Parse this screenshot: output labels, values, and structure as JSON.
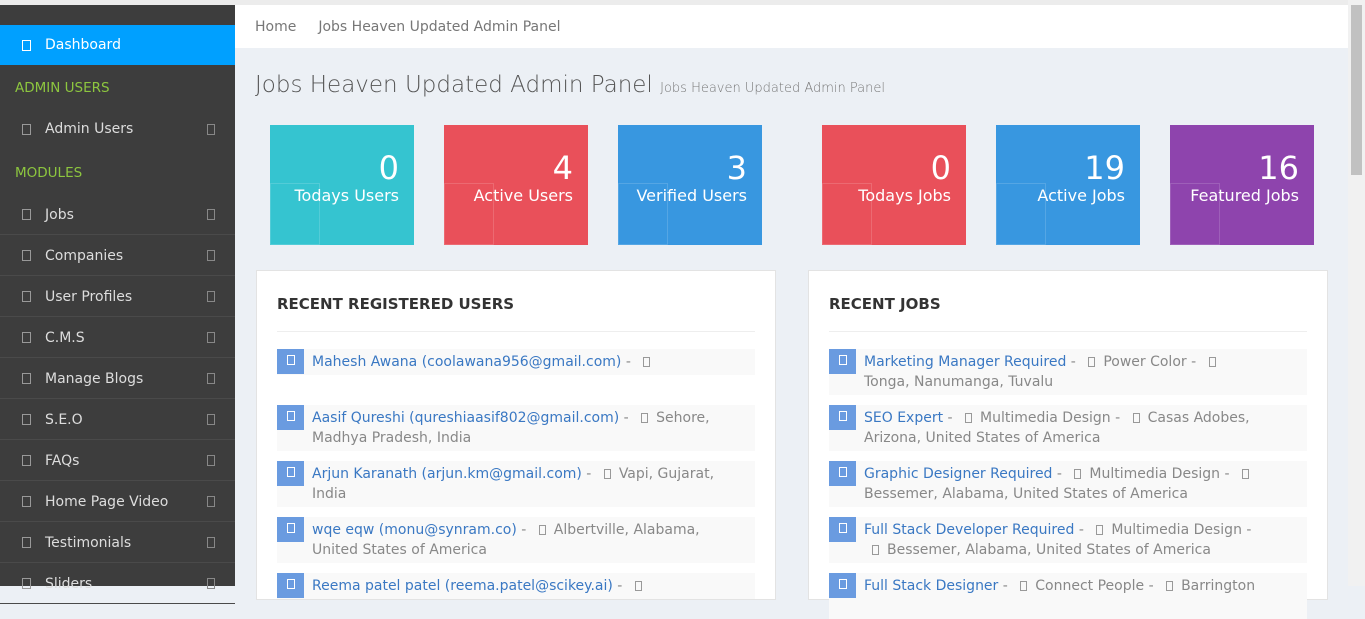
{
  "sidebar": {
    "dashboard": "Dashboard",
    "section_admin": "ADMIN USERS",
    "admin_users": "Admin Users",
    "section_modules": "MODULES",
    "items": [
      "Jobs",
      "Companies",
      "User Profiles",
      "C.M.S",
      "Manage Blogs",
      "S.E.O",
      "FAQs",
      "Home Page Video",
      "Testimonials",
      "Sliders"
    ]
  },
  "breadcrumb": {
    "home": "Home",
    "current": "Jobs Heaven Updated Admin Panel"
  },
  "page": {
    "title": "Jobs Heaven Updated Admin Panel",
    "subtitle": "Jobs Heaven Updated Admin Panel"
  },
  "stats": [
    {
      "value": "0",
      "label": "Todays Users",
      "color": "#35c4d0"
    },
    {
      "value": "4",
      "label": "Active Users",
      "color": "#e9505a"
    },
    {
      "value": "3",
      "label": "Verified Users",
      "color": "#3897e0"
    },
    {
      "value": "0",
      "label": "Todays Jobs",
      "color": "#e9505a"
    },
    {
      "value": "19",
      "label": "Active Jobs",
      "color": "#3897e0"
    },
    {
      "value": "16",
      "label": "Featured Jobs",
      "color": "#8e44ad"
    }
  ],
  "users": {
    "title": "RECENT REGISTERED USERS",
    "rows": [
      {
        "name": "Mahesh Awana (coolawana956@gmail.com)",
        "location": ""
      },
      {
        "name": "Aasif Qureshi (qureshiaasif802@gmail.com)",
        "location": "Sehore, Madhya Pradesh, India"
      },
      {
        "name": "Arjun Karanath (arjun.km@gmail.com)",
        "location": "Vapi, Gujarat, India"
      },
      {
        "name": "wqe eqw (monu@synram.co)",
        "location": "Albertville, Alabama, United States of America"
      },
      {
        "name": "Reema patel patel (reema.patel@scikey.ai)",
        "location": ""
      }
    ]
  },
  "jobs": {
    "title": "RECENT JOBS",
    "rows": [
      {
        "title": "Marketing Manager Required",
        "company": "Power Color",
        "location": "Tonga, Nanumanga, Tuvalu"
      },
      {
        "title": "SEO Expert",
        "company": "Multimedia Design",
        "location": "Casas Adobes, Arizona, United States of America"
      },
      {
        "title": "Graphic Designer Required",
        "company": "Multimedia Design",
        "location": "Bessemer, Alabama, United States of America"
      },
      {
        "title": "Full Stack Developer Required",
        "company": "Multimedia Design",
        "location": "Bessemer, Alabama, United States of America"
      },
      {
        "title": "Full Stack Designer",
        "company": "Connect People",
        "location": "Barrington"
      }
    ]
  }
}
